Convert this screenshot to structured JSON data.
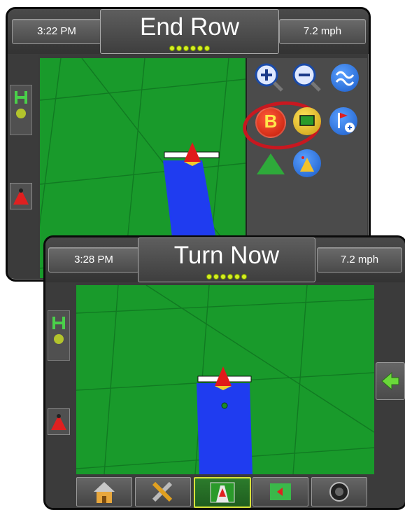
{
  "back_screen": {
    "time": "3:22 PM",
    "title": "End Row",
    "speed": "7.2 mph",
    "gps_dots": 6,
    "map_tools": [
      "zoom-in-icon",
      "zoom-out-icon",
      "curve-guidance-icon",
      "mark-b-icon",
      "boundary-icon",
      "add-flag-icon",
      "vehicle-view-icon",
      "nudge-icon"
    ],
    "mark_b_label": "B"
  },
  "front_screen": {
    "time": "3:28 PM",
    "title": "Turn Now",
    "speed": "7.2 mph",
    "gps_dots": 6,
    "bottom_nav": [
      "home-icon",
      "tools-icon",
      "guidance-icon",
      "map-icon",
      "camera-icon"
    ],
    "active_tab": "guidance-icon"
  },
  "colors": {
    "field_green": "#199a2b",
    "coverage_blue": "#1f3cf0",
    "highlight_red": "#c81820",
    "gps_dot": "#d6ee22"
  }
}
